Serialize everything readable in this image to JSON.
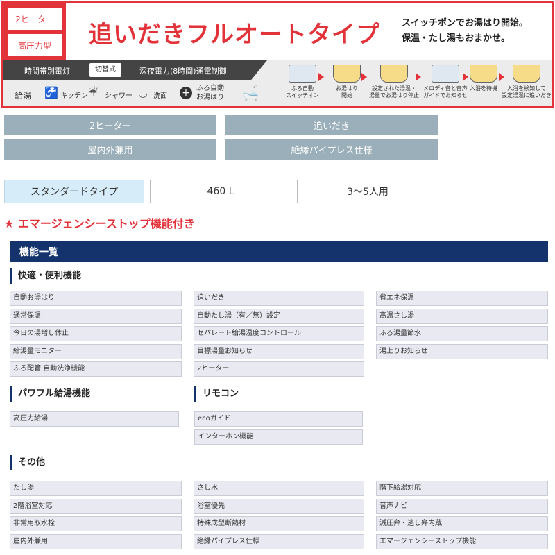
{
  "banner": {
    "badge_top": "2ヒーター",
    "badge_bottom": "高圧力型",
    "title": "追いだきフルオートタイプ",
    "subtitle_line1": "スイッチポンでお湯はり開始。",
    "subtitle_line2": "保温・たし湯もおまかせ。",
    "tariff_left": "時間帯別電灯",
    "switch_label": "切替式",
    "tariff_right": "深夜電力(8時間)通電制御",
    "supply_label": "給湯",
    "kitchen_label": "キッチン",
    "shower_label": "シャワー",
    "washbasin_label": "洗面",
    "bath_label_1": "ふろ自動",
    "bath_label_2": "お湯はり",
    "steps": [
      {
        "line1": "ふろ自動",
        "line2": "スイッチオン"
      },
      {
        "line1": "お湯はり",
        "line2": "開始"
      },
      {
        "line1": "設定された湯温・",
        "line2": "湯量でお湯はり停止"
      },
      {
        "line1": "メロディ音と音声",
        "line2": "ガイドでお知らせ"
      },
      {
        "line1": "入浴を待機",
        "line2": ""
      },
      {
        "line1": "入浴を検知して",
        "line2": "設定湯温に追いだき"
      }
    ]
  },
  "features": [
    "2ヒーター",
    "追いだき",
    "屋内外兼用",
    "絶縁パイプレス仕様"
  ],
  "specs": [
    "スタンダードタイプ",
    "460 L",
    "3〜5人用"
  ],
  "notice": "★ エマージェンシーストップ機能付き",
  "function_list": {
    "title": "機能一覧",
    "comfort": {
      "heading": "快適・便利機能",
      "col1": [
        "自動お湯はり",
        "通常保温",
        "今日の湯増し休止",
        "給湯量モニター",
        "ふろ配管 自動洗浄機能"
      ],
      "col2": [
        "追いだき",
        "自動たし湯（有／無）設定",
        "セパレート給湯温度コントロール",
        "目標湯量お知らせ",
        "2ヒーター"
      ],
      "col3": [
        "省エネ保温",
        "高温さし湯",
        "ふろ湯量節水",
        "湯上りお知らせ"
      ]
    },
    "powerful": {
      "heading": "パワフル給湯機能",
      "items": [
        "高圧力給湯"
      ]
    },
    "remote": {
      "heading": "リモコン",
      "items": [
        "ecoガイド",
        "インターホン機能"
      ]
    },
    "other": {
      "heading": "その他",
      "col1": [
        "たし湯",
        "2階浴室対応",
        "非常用取水栓",
        "屋内外兼用"
      ],
      "col2": [
        "さし水",
        "浴室優先",
        "特殊成型断熱材",
        "絶縁パイプレス仕様"
      ],
      "col3": [
        "階下給湯対応",
        "音声ナビ",
        "減圧弁・逃し弁内蔵",
        "エマージェンシーストップ機能"
      ]
    }
  }
}
